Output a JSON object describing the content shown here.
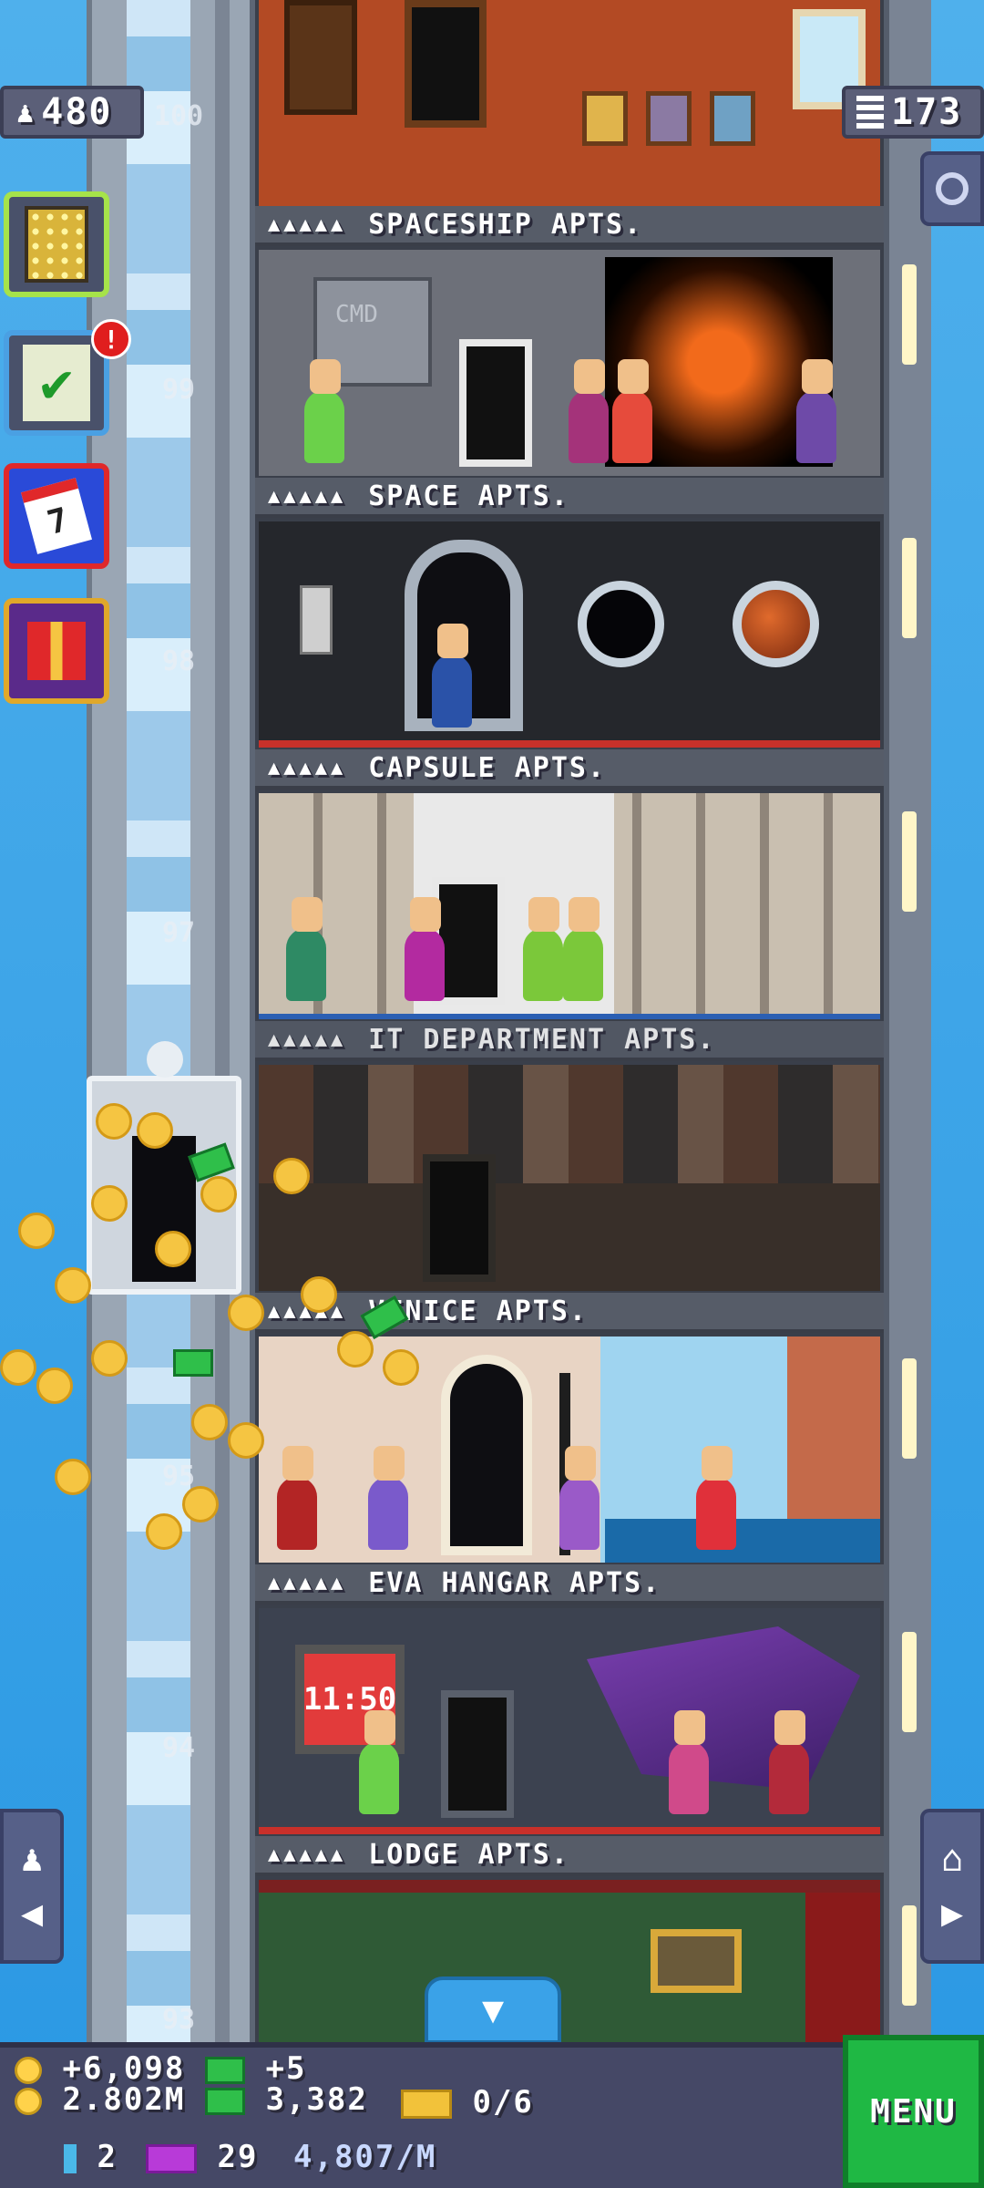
{
  "hud": {
    "population": "480",
    "floors": "173"
  },
  "floors": [
    {
      "name": "SPACESHIP APTS.",
      "number": "99",
      "stars": "▲▲▲▲▲"
    },
    {
      "name": "SPACE APTS.",
      "number": "98",
      "stars": "▲▲▲▲▲"
    },
    {
      "name": "CAPSULE APTS.",
      "number": "97",
      "stars": "▲▲▲▲▲"
    },
    {
      "name": "IT DEPARTMENT APTS.",
      "number": "96",
      "stars": "▲▲▲▲▲"
    },
    {
      "name": "VENICE APTS.",
      "number": "95",
      "stars": "▲▲▲▲▲"
    },
    {
      "name": "EVA HANGAR APTS.",
      "number": "94",
      "stars": "▲▲▲▲▲"
    },
    {
      "name": "LODGE APTS.",
      "number": "93",
      "stars": "▲▲▲▲▲"
    }
  ],
  "top_floor_number": "100",
  "side_buttons": {
    "notification_badge": "!",
    "calendar_day": "7"
  },
  "bottom": {
    "coin_income": "+6,098",
    "coins_total": "2.802M",
    "bux_income": "+5",
    "bux_total": "3,382",
    "vip_progress": "0/6",
    "elevators": "2",
    "tickets": "29",
    "rate": "4,807/M"
  },
  "menu_label": "MENU",
  "room_text": {
    "spaceship_panel": "CMD",
    "eva_clock": "11:50"
  },
  "colors": {
    "sky": "#2b9be6",
    "menu_green": "#1fb844",
    "hud_purple": "#5b5f78"
  }
}
